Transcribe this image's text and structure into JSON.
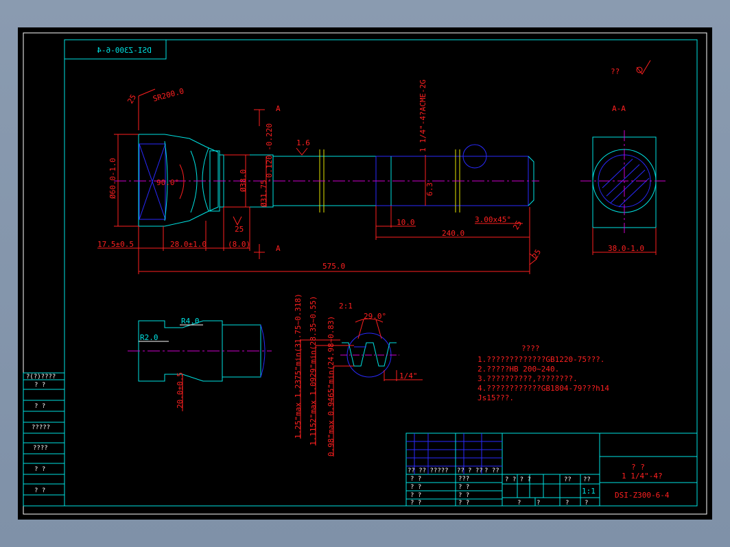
{
  "drawing": {
    "title_mirrored": "DSI-Z300-6-4",
    "roughness_symbol_label": "??",
    "section_label_a": "A",
    "section_view_title": "A-A",
    "detail_scale": "2:1",
    "dims": {
      "sr200": "SR200.0",
      "r25_a": "25",
      "dia60": "Ø60.0-1.0",
      "angle90": "90.0°",
      "dia38": "Ø38.0",
      "dia31": "Ø31.75",
      "tol31": "-0.120 -0.220",
      "r25_b": "25",
      "d175": "17.5±0.5",
      "d28": "28.0±1.0",
      "d8": "(8.0)",
      "d575": "575.0",
      "rough16": "1.6",
      "thread_spec": "1 1/4\"-4?ACME-2G",
      "rough63": "6.3",
      "d10": "10.0",
      "chamfer": "3.00x45°",
      "d240": "240.0",
      "rough25_c": "25",
      "rough25_d": "25",
      "d38": "38.0-1.0",
      "r4": "R4.0",
      "r2": "R2.0",
      "d20": "20.0±0.5",
      "angle29": "29.0°",
      "pitch": "1/4\"",
      "thread_d1": "1.25\"max 1.2375\"min(31.75~0.318)",
      "thread_d2": "1.1152\"max 1.0929\"min(28.35~0.55)",
      "thread_d3": "0.98\"max 0.9465\"min(24.98~0.83)"
    },
    "notes": {
      "title": "????",
      "lines": [
        "1.?????????????GB1220-75???.",
        "2.?????HB 200~240.",
        "3.??????????,????????.",
        "4.????????????GB1804-79???h14",
        "  Js15???."
      ]
    },
    "left_strip": {
      "header": "?(?)????",
      "rows": [
        "? ?",
        "? ?",
        "?????",
        "????",
        "? ?",
        "? ?"
      ]
    },
    "title_block": {
      "name_line1": "? ?",
      "name_line2": "1 1/4\"-4?",
      "drawing_no": "DSI-Z300-6-4",
      "scale": "1:1",
      "row_labels": {
        "r1a": "?? ?? ?????",
        "r1b": "??",
        "r1c": "? ??",
        "r1d": "? ??",
        "mid1": "? ? ? ?",
        "mid2": "??",
        "mid3": "??",
        "r2a": "? ?",
        "r2b": "???",
        "r3a": "? ?",
        "r3b": "? ?",
        "r4a": "? ?",
        "r4b": "? ?",
        "r5a": "? ?",
        "r5b": "? ?",
        "bot1": "?",
        "bot2": "?",
        "bot3": "?",
        "bot4": "?"
      }
    }
  }
}
